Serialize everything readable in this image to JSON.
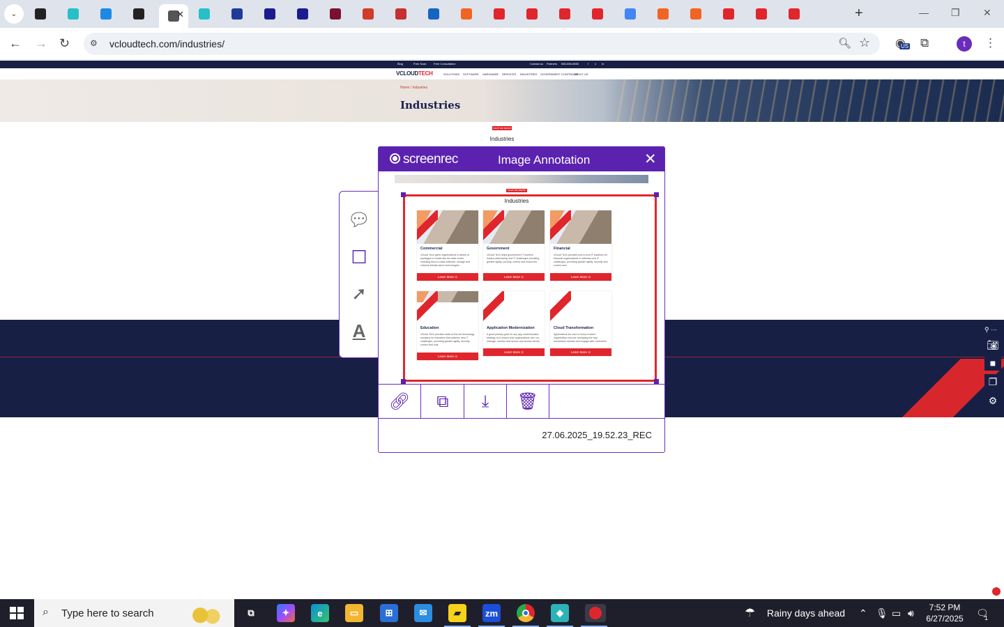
{
  "browser": {
    "active_tab_close": "✕",
    "new_tab": "+",
    "url": "vcloudtech.com/industries/",
    "profile_initial": "t",
    "vpn_badge": "US",
    "tab_colors": [
      "#222222",
      "#27c0c8",
      "#1e88e5",
      "#222222",
      "#555555",
      "#27c0c8",
      "#1f3b9a",
      "#1b1b8f",
      "#1b1b8f",
      "#7a1030",
      "#d23a2a",
      "#c53030",
      "#1565c0",
      "#f06524",
      "#e0262c",
      "#e0262c",
      "#e0262c",
      "#e0262c",
      "#4285f4",
      "#f06524",
      "#f06524",
      "#e0262c",
      "#e0262c",
      "#e0262c"
    ]
  },
  "website": {
    "topbar": [
      "Blog",
      "Free Scan",
      "Free Consultation",
      "Contact us",
      "Partners",
      "555-555-5555"
    ],
    "logo_main": "VCLOUD",
    "logo_accent": "TECH",
    "nav": [
      "SOLUTIONS",
      "SOFTWARE",
      "HARDWARE",
      "SERVICES",
      "INDUSTRIES",
      "GOVERNMENT CONTRACTS",
      "ABOUT US"
    ],
    "breadcrumb": "Home  /  Industries",
    "hero_title": "Industries",
    "section_badge": "WHAT WE SERVE",
    "section_title": "Industries"
  },
  "palette": {
    "tools": [
      "comment-tool",
      "rectangle-tool",
      "arrow-tool",
      "text-tool"
    ]
  },
  "dialog": {
    "brand": "screenrec",
    "title": "Image Annotation",
    "close": "✕",
    "filename": "27.06.2025_19.52.23_REC",
    "thumb_badge": "WHAT WE SERVE",
    "thumb_title": "Industries",
    "cards": [
      {
        "name": "Commercial",
        "text": "vCloud Tech gives organizations a variety of packages to modernize the data center, including best-in-class software, storage and network infrastructure technologies.",
        "button": "Learn More ⊙"
      },
      {
        "name": "Government",
        "text": "vCloud Tech helps government IT achieve today's addressing new IT challenges providing greater agility, security, control and resources.",
        "button": "Learn More ⊙"
      },
      {
        "name": "Financial",
        "text": "vCloud Tech provides end-to-end IT solutions for financial organizations to address new IT challenges, providing greater agility, security and control over.",
        "button": "Learn More ⊙"
      },
      {
        "name": "Education",
        "text": "vCloud Tech provides state-of-the-art technology solutions for education that address new IT challenges, providing greater agility, security, control and cost.",
        "button": "Learn More ⊙"
      },
      {
        "name": "Application Modernization",
        "text": "A good primary goal for any app modernization strategy is to ensure that organizations can run, manage, monitor and secure any access trends.",
        "button": "Learn More ⊙"
      },
      {
        "name": "Cloud Transformation",
        "text": "Applications are core to every modern organization and are reshaping the way businesses interact and engage with customers.",
        "button": "Learn More ⊙"
      }
    ],
    "actions": [
      "link",
      "copy",
      "download",
      "delete"
    ]
  },
  "taskbar": {
    "search_placeholder": "Type here to search",
    "weather": "Rainy days ahead",
    "time": "7:52 PM",
    "date": "6/27/2025",
    "notification_count": "1"
  }
}
